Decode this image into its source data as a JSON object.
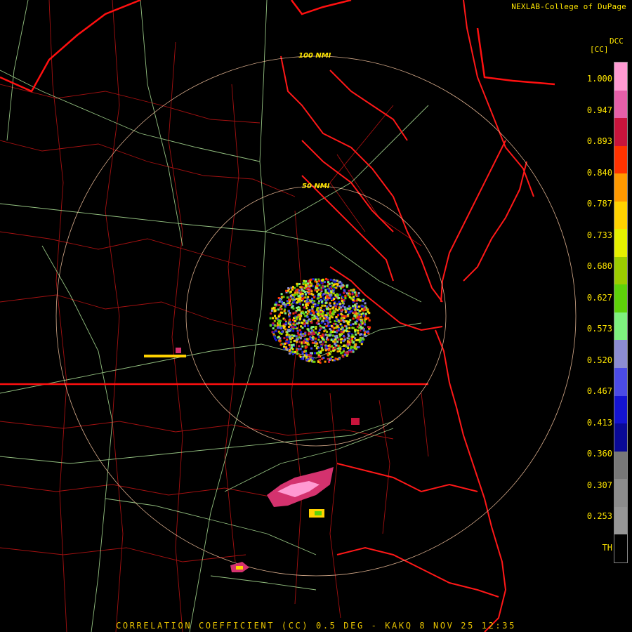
{
  "credit": "NEXLAB-College of DuPage",
  "footer": "CORRELATION COEFFICIENT (CC) 0.5 DEG - KAKQ 8 NOV 25 12:35",
  "range_rings": {
    "inner": "50 NMI",
    "outer": "100 NMI"
  },
  "legend": {
    "product": "DCC",
    "unit": "[CC]",
    "ticks": [
      "1.000",
      "0.947",
      "0.893",
      "0.840",
      "0.787",
      "0.733",
      "0.680",
      "0.627",
      "0.573",
      "0.520",
      "0.467",
      "0.413",
      "0.360",
      "0.307",
      "0.253",
      "TH"
    ],
    "colors": [
      "#ff9ad2",
      "#e65fa8",
      "#c8143c",
      "#ff3300",
      "#ff9900",
      "#ffd200",
      "#e6f000",
      "#9ccc00",
      "#5ed20a",
      "#7ef07e",
      "#8c8cd2",
      "#4b4be6",
      "#1414d2",
      "#0a0a96",
      "#787878",
      "#8c8c8c",
      "#969696",
      "#000000"
    ]
  },
  "colors": {
    "state": "#ff1010",
    "coast": "#ff1818",
    "county": "#c01414",
    "highway": "#b8f0a0",
    "ring": "#ffcba4"
  }
}
